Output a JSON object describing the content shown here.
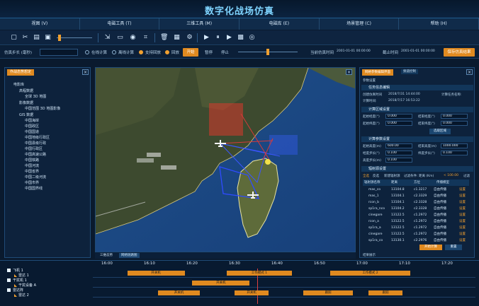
{
  "app": {
    "title": "数字化战场仿真"
  },
  "menu": [
    "视图 (V)",
    "电磁工具 (T)",
    "三维工具 (M)",
    "电磁库 (E)",
    "场景管理 (C)",
    "帮助 (H)"
  ],
  "toolbar": {
    "icons": [
      "new-file-icon",
      "cut-icon",
      "copy-icon",
      "save-icon",
      "slider-handle-icon",
      "import-icon",
      "open-folder-icon",
      "record-icon",
      "crop-icon",
      "delete-icon",
      "grid-icon",
      "settings-icon",
      "play-icon",
      "pause-icon",
      "video-icon",
      "image-icon",
      "eye-icon"
    ]
  },
  "simbar": {
    "step_label": "仿真步长 (毫秒)",
    "online_label": "在线计算",
    "offline_label": "离线计算",
    "support_replay_label": "支持回放",
    "replay_label": "回放",
    "start_button": "开始",
    "pause_label": "暂停",
    "stop_label": "停止",
    "current_time_label": "当前仿真时间",
    "current_time_value": "2001-01-01 00:00:00",
    "end_time_label": "截止时间",
    "end_time_value": "2001-01-01 00:00:00",
    "save_button": "保存仿真结果"
  },
  "left_panel": {
    "tab_label": "作战态势想定",
    "tree": [
      "电影库",
      "高程数据",
      "全球 3D 地图",
      "影像数据",
      "中国范围 3D 地图影像",
      "GIS 数据",
      "中国海岸",
      "中国政区",
      "中国国道",
      "中国地级行政区",
      "中国县级行政",
      "中国行政区",
      "中国高速公路",
      "中国铁路",
      "中国河流",
      "中国省界",
      "中国二级河流",
      "中国市界",
      "中国国界线"
    ]
  },
  "map_tabs": {
    "tab1": "三维态势",
    "tab2": "网络链路图"
  },
  "right_panel": {
    "tab1": "网格参数编辑界面",
    "tab2": "频道控制",
    "header": "参数设置",
    "sec_task": "任务信息编辑",
    "create_time_label": "创建仿真时间",
    "create_time_value": "2018/7/31 14:44:00",
    "task_name_label": "计算任务名称:",
    "calc_time_label": "计算时间:",
    "calc_time_value": "2018/7/17 16:53:22",
    "sec_region": "计算区域设置",
    "start_lon_label": "起始经度(°)",
    "start_lon_value": "0.000",
    "end_lon_label": "结束经度(°)",
    "end_lon_value": "0.000",
    "start_lat_label": "起始纬度(°)",
    "start_lat_value": "0.000",
    "end_lat_label": "结束纬度(°)",
    "end_lat_value": "0.000",
    "select_region_button": "选取区域",
    "sec_param": "计算参数设置",
    "start_alt_label": "起始高度(m)",
    "start_alt_value": "600.00",
    "end_alt_label": "结束高度(m)",
    "end_alt_value": "1000.000",
    "lon_step_label": "经度步长(°)",
    "lon_step_value": "0.100",
    "lat_step_label": "纬度步长(°)",
    "lat_step_value": "0.100",
    "height_step_label": "高度步长(m)",
    "height_step_value": "0.100",
    "sec_source": "辐射源设置",
    "filter_all": "全选",
    "filter_invert": "反选",
    "filter_new": "新建辐射源",
    "filter_conditions": "过滤条件: 距离 (Km)",
    "filter_value": "< 100.00",
    "filter_button": "过滤",
    "grid_headers": [
      "辐射源名称",
      "距离",
      "方位",
      "传播模型"
    ],
    "grid_rows": [
      [
        "mas_co",
        "13104.8",
        "c1.3217",
        "自由传播",
        "设置"
      ],
      [
        "mas_1",
        "13104.1",
        "c2.3329",
        "自由传播",
        "设置"
      ],
      [
        "rcon_b",
        "13104.1",
        "c2.3328",
        "自由传播",
        "设置"
      ],
      [
        "sp1ra_nco",
        "13104.2",
        "c2.3328",
        "自由传播",
        "设置"
      ],
      [
        "cinegare",
        "13122.5",
        "c1.2972",
        "自由传播",
        "设置"
      ],
      [
        "rcon_a",
        "13122.5",
        "c1.2972",
        "自由传播",
        "设置"
      ],
      [
        "sp1ra_a",
        "13122.5",
        "c1.2972",
        "自由传播",
        "设置"
      ],
      [
        "cinegare",
        "13122.5",
        "c1.2972",
        "自由传播",
        "设置"
      ],
      [
        "sp1ra_co",
        "13130.1",
        "c2.2976",
        "自由传播",
        "设置"
      ]
    ],
    "start_calc_button": "开始计算",
    "reset_button": "重置",
    "result_label": "结果展示"
  },
  "timeline": {
    "ticks": [
      "16:00",
      "16:10",
      "16:20",
      "16:30",
      "16:40",
      "16:50",
      "17:00",
      "17:10",
      "17:20"
    ],
    "rows": [
      {
        "label": "飞机 1",
        "type": "check"
      },
      {
        "label": "雷达 1",
        "type": "flag"
      },
      {
        "label": "干扰机 1",
        "type": "check"
      },
      {
        "label": "干扰设备 A",
        "type": "flag"
      },
      {
        "label": "雷达阵",
        "type": "check"
      },
      {
        "label": "雷达 2",
        "type": "flag"
      }
    ],
    "bars": {
      "row1": [
        [
          "开关机",
          0.09,
          0.24
        ],
        [
          "工作模式 1",
          0.35,
          0.52
        ],
        [
          "工作模式 2",
          0.62,
          0.83
        ]
      ],
      "row2": [
        [
          "开关机",
          0.26,
          0.41
        ]
      ],
      "row3": [
        [
          "开关机",
          0.17,
          0.28
        ],
        [
          "开关机",
          0.37,
          0.46
        ],
        [
          "跟踪",
          0.55,
          0.68
        ],
        [
          "跟踪",
          0.72,
          0.81
        ]
      ]
    }
  }
}
